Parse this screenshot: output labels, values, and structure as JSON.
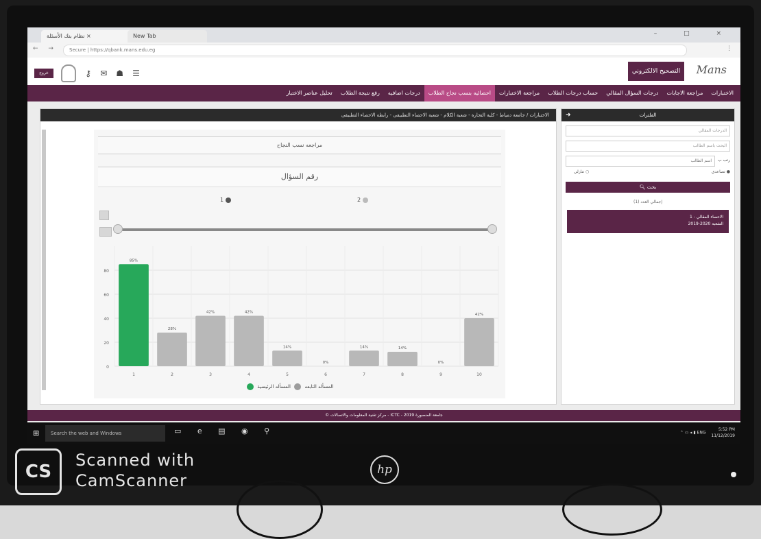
{
  "browser": {
    "tab1_label": "نظام بنك الأسئلة ×",
    "tab2_label": "New Tab",
    "url": "Secure | https://qbank.mans.edu.eg",
    "window_controls": "– □ ×"
  },
  "header": {
    "brand_title": "التصحيح الالكتروني",
    "logo_text": "Mans",
    "logout_label": "خروج"
  },
  "main_nav": {
    "items": [
      {
        "label": "الاختبارات",
        "active": false
      },
      {
        "label": "مراجعة الاجابات",
        "active": false
      },
      {
        "label": "درجات السؤال المقالي",
        "active": false
      },
      {
        "label": "حساب درجات الطلاب",
        "active": false
      },
      {
        "label": "مراجعة الاختبارات",
        "active": false
      },
      {
        "label": "احصائيه بنسب نجاح الطلاب",
        "active": true
      },
      {
        "label": "درجات اضافيه",
        "active": false
      },
      {
        "label": "رفع نتيجة الطلاب",
        "active": false
      },
      {
        "label": "تحليل عناصر الاختبار",
        "active": false
      }
    ]
  },
  "breadcrumb": "الاختبارات / جامعة دمياط - كلية التجارة - شعبة الكلام - شعبة الاحصاء التطبيقى - رابطة الاحصاء التطبيقى",
  "pane": {
    "title": "مراجعه نسب النجاح",
    "question_heading": "رقم السؤال",
    "radio1": "1",
    "radio2": "2"
  },
  "chart_data": {
    "type": "bar",
    "categories": [
      "1",
      "2",
      "3",
      "4",
      "5",
      "6",
      "7",
      "8",
      "9",
      "10"
    ],
    "values": [
      85,
      28,
      42,
      42,
      13,
      0,
      13,
      12,
      0,
      40
    ],
    "labels": [
      "85%",
      "28%",
      "42%",
      "42%",
      "14%",
      "0%",
      "14%",
      "14%",
      "0%",
      "42%"
    ],
    "ylim": [
      0,
      100
    ],
    "yticks": [
      0,
      20,
      40,
      60,
      80
    ],
    "highlight_index": 0,
    "colors": {
      "highlight": "#27a85a",
      "default": "#b8b8b8"
    },
    "legend": [
      {
        "name": "المسأله التابعه",
        "color": "#27a85a"
      },
      {
        "name": "المسأله الرئيسية",
        "color": "#9c9c9c"
      }
    ]
  },
  "right_panel": {
    "title": "الفلترات",
    "input1_placeholder": "الدرجات المقالي",
    "input2_placeholder": "البحث باسم الطالب",
    "select_value": "اسم الطالب",
    "select_label": "رتب ب",
    "radio_asc": "تصاعدي",
    "radio_desc": "تنازلي",
    "search_button": "بحث",
    "total": "إجمالي العدد (1)",
    "result_line1": "1 - الاحصاء المقالي",
    "result_line2": "2019-2020 الشعبة"
  },
  "footer": "© مركز تقنية المعلومات والاتصالات - ICTC - جامعة المنصورة 2019",
  "taskbar": {
    "search_placeholder": "Search the web and Windows",
    "time": "5:52 PM",
    "date": "11/12/2019",
    "lang": "ENG"
  },
  "watermark": {
    "logo": "CS",
    "line1": "Scanned with",
    "line2": "CamScanner"
  },
  "bezel_logo": "hp"
}
